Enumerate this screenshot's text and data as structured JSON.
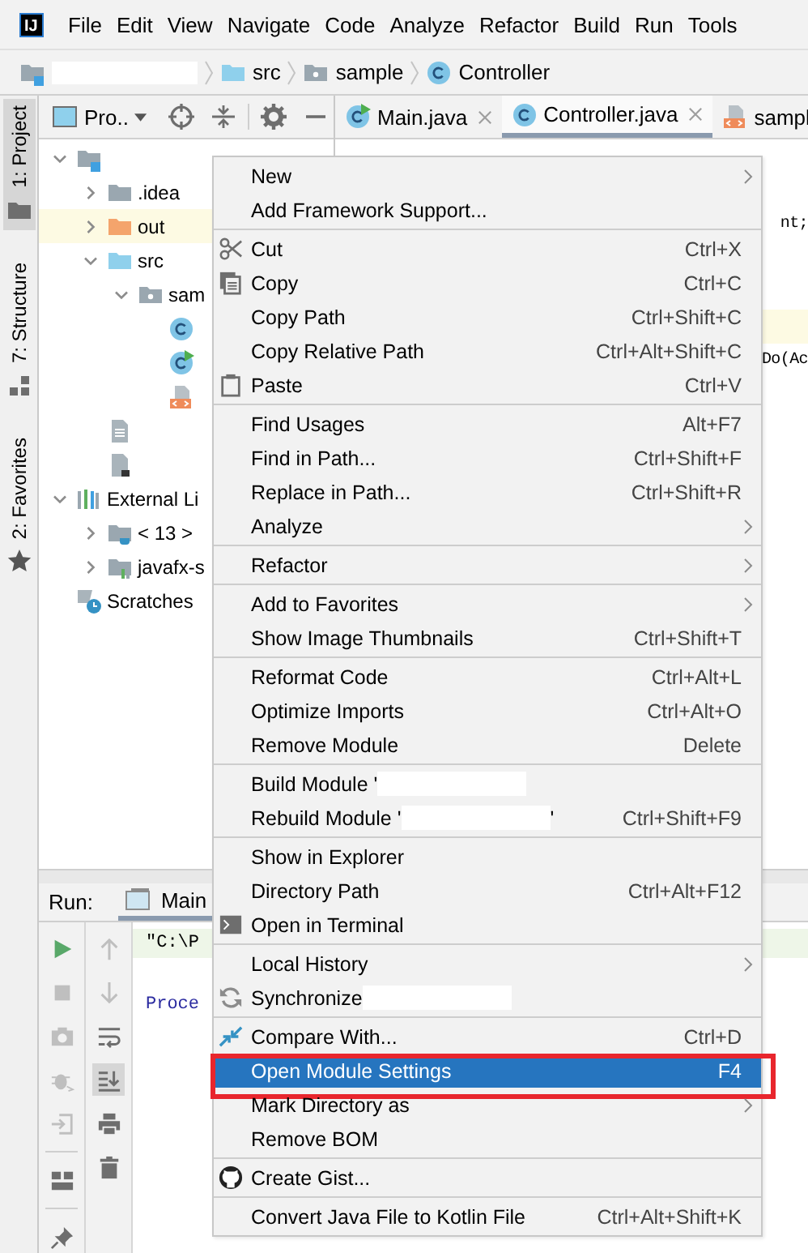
{
  "menubar": {
    "logo": "IJ",
    "items": [
      "File",
      "Edit",
      "View",
      "Navigate",
      "Code",
      "Analyze",
      "Refactor",
      "Build",
      "Run",
      "Tools"
    ]
  },
  "breadcrumb": [
    {
      "kind": "module",
      "redacted": true
    },
    {
      "kind": "source",
      "label": "src"
    },
    {
      "kind": "package",
      "label": "sample"
    },
    {
      "kind": "class",
      "label": "Controller"
    }
  ],
  "side_tabs": [
    {
      "label": "1: Project",
      "selected": true
    },
    {
      "label": "7: Structure",
      "selected": false
    },
    {
      "label": "2: Favorites",
      "selected": false
    }
  ],
  "project": {
    "title": "Pro..",
    "tree": [
      {
        "kind": "module",
        "expanded": true,
        "highlighted": false,
        "children": [
          {
            "kind": "folder",
            "label": ".idea",
            "expanded": false,
            "highlighted": false
          },
          {
            "kind": "excluded",
            "label": "out",
            "expanded": false,
            "highlighted": true
          },
          {
            "kind": "source",
            "label": "src",
            "expanded": true,
            "highlighted": false,
            "children": [
              {
                "kind": "package",
                "label": "sam",
                "expanded": true,
                "highlighted": false,
                "children": [
                  {
                    "kind": "class",
                    "highlighted": false
                  },
                  {
                    "kind": "main-class",
                    "highlighted": false
                  },
                  {
                    "kind": "fxml",
                    "highlighted": false
                  }
                ]
              }
            ]
          },
          {
            "kind": "file",
            "highlighted": false
          },
          {
            "kind": "file-dark",
            "highlighted": false
          }
        ]
      },
      {
        "kind": "library",
        "label": "External Li",
        "expanded": true,
        "highlighted": false,
        "children": [
          {
            "kind": "jdk",
            "label": "< 13 >",
            "expanded": false,
            "highlighted": false
          },
          {
            "kind": "lib-jar",
            "label": "javafx-s",
            "expanded": false,
            "highlighted": false
          }
        ]
      },
      {
        "kind": "scratches",
        "label": "Scratches",
        "highlighted": false
      }
    ]
  },
  "editor": {
    "tabs": [
      {
        "kind": "main-class",
        "label": "Main.java",
        "selected": false,
        "closable": true
      },
      {
        "kind": "class",
        "label": "Controller.java",
        "selected": true,
        "closable": true
      },
      {
        "kind": "fxml",
        "label": "sampl",
        "selected": false,
        "closable": false
      }
    ],
    "lines": [
      {
        "kind": "full",
        "current": false
      },
      {
        "kind": "full",
        "current": false
      },
      {
        "text": "nt;",
        "kind": "tail",
        "current": false
      },
      {
        "kind": "full",
        "current": false
      },
      {
        "kind": "full",
        "current": false
      },
      {
        "kind": "full",
        "current": true
      },
      {
        "text": "Do(Ac",
        "kind": "tail",
        "current": false
      }
    ]
  },
  "run": {
    "title": "Run:",
    "tabs": [
      {
        "label": "Main",
        "selected": true
      }
    ],
    "toolbar_1": [
      {
        "kind": "run",
        "disabled": false,
        "selected": false
      },
      {
        "kind": "stop",
        "disabled": true,
        "selected": false
      },
      {
        "kind": "camera",
        "disabled": true,
        "selected": false
      },
      {
        "kind": "bug",
        "disabled": true,
        "selected": false
      },
      {
        "kind": "exit",
        "disabled": true,
        "selected": false
      },
      {
        "kind": "separator"
      },
      {
        "kind": "layout",
        "disabled": false,
        "selected": false
      },
      {
        "kind": "separator"
      },
      {
        "kind": "pin",
        "disabled": false,
        "selected": false
      }
    ],
    "toolbar_2": [
      {
        "kind": "up",
        "disabled": true,
        "selected": false
      },
      {
        "kind": "down",
        "disabled": true,
        "selected": false
      },
      {
        "kind": "wrap",
        "disabled": false,
        "selected": false
      },
      {
        "kind": "scroll-end",
        "disabled": false,
        "selected": true
      },
      {
        "kind": "print",
        "disabled": false,
        "selected": false
      },
      {
        "kind": "trash",
        "disabled": false,
        "selected": false
      }
    ],
    "console": [
      {
        "text": "\"C:\\P",
        "kind": "command"
      },
      {
        "text": "Proce",
        "kind": "exit"
      }
    ]
  },
  "context_menu": [
    {
      "label": "New",
      "submenu": true,
      "selected": false
    },
    {
      "label": "Add Framework Support...",
      "selected": false
    },
    {
      "kind": "separator"
    },
    {
      "label": "Cut",
      "shortcut": "Ctrl+X",
      "selected": false
    },
    {
      "label": "Copy",
      "shortcut": "Ctrl+C",
      "selected": false
    },
    {
      "label": "Copy Path",
      "shortcut": "Ctrl+Shift+C",
      "selected": false
    },
    {
      "label": "Copy Relative Path",
      "shortcut": "Ctrl+Alt+Shift+C",
      "selected": false
    },
    {
      "label": "Paste",
      "shortcut": "Ctrl+V",
      "selected": false
    },
    {
      "kind": "separator"
    },
    {
      "label": "Find Usages",
      "shortcut": "Alt+F7",
      "selected": false
    },
    {
      "label": "Find in Path...",
      "shortcut": "Ctrl+Shift+F",
      "selected": false
    },
    {
      "label": "Replace in Path...",
      "shortcut": "Ctrl+Shift+R",
      "selected": false
    },
    {
      "label": "Analyze",
      "submenu": true,
      "selected": false
    },
    {
      "kind": "separator"
    },
    {
      "label": "Refactor",
      "submenu": true,
      "selected": false
    },
    {
      "kind": "separator"
    },
    {
      "label": "Add to Favorites",
      "submenu": true,
      "selected": false
    },
    {
      "label": "Show Image Thumbnails",
      "shortcut": "Ctrl+Shift+T",
      "selected": false
    },
    {
      "kind": "separator"
    },
    {
      "label": "Reformat Code",
      "shortcut": "Ctrl+Alt+L",
      "selected": false
    },
    {
      "label": "Optimize Imports",
      "shortcut": "Ctrl+Alt+O",
      "selected": false
    },
    {
      "label": "Remove Module",
      "shortcut": "Delete",
      "selected": false
    },
    {
      "kind": "separator"
    },
    {
      "label": "Build Module '",
      "redacted": true,
      "selected": false
    },
    {
      "label": "Rebuild Module '",
      "redacted": true,
      "suffix": "'",
      "shortcut": "Ctrl+Shift+F9",
      "selected": false
    },
    {
      "kind": "separator"
    },
    {
      "label": "Show in Explorer",
      "selected": false
    },
    {
      "label": "Directory Path",
      "shortcut": "Ctrl+Alt+F12",
      "selected": false
    },
    {
      "label": "Open in Terminal",
      "selected": false
    },
    {
      "kind": "separator"
    },
    {
      "label": "Local History",
      "submenu": true,
      "selected": false
    },
    {
      "label": "Synchronize",
      "redacted": true,
      "selected": false
    },
    {
      "kind": "separator"
    },
    {
      "label": "Compare With...",
      "shortcut": "Ctrl+D",
      "selected": false
    },
    {
      "label": "Open Module Settings",
      "shortcut": "F4",
      "selected": true,
      "annotated": true
    },
    {
      "label": "Mark Directory as",
      "submenu": true,
      "selected": false
    },
    {
      "label": "Remove BOM",
      "selected": false
    },
    {
      "kind": "separator"
    },
    {
      "label": "Create Gist...",
      "selected": false
    },
    {
      "kind": "separator"
    },
    {
      "label": "Convert Java File to Kotlin File",
      "shortcut": "Ctrl+Alt+Shift+K",
      "selected": false
    }
  ]
}
